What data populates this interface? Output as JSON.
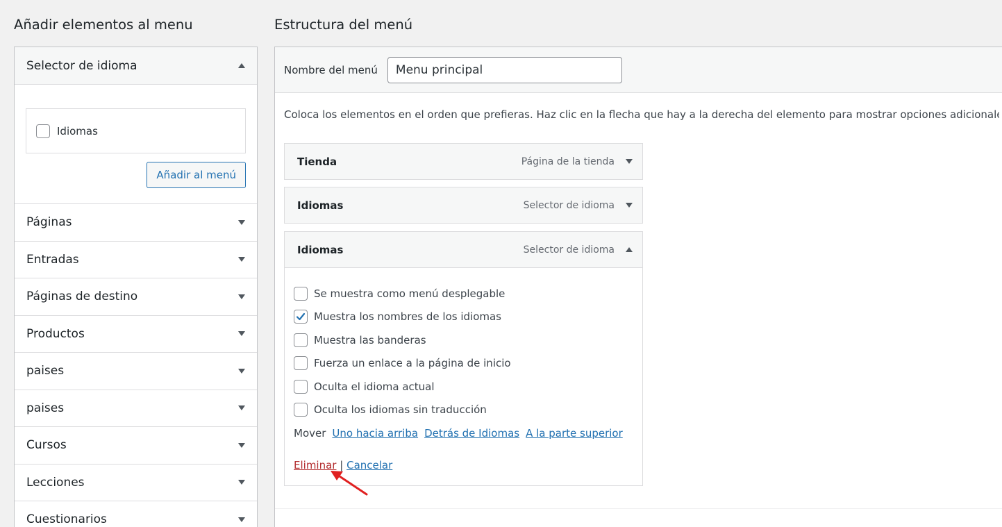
{
  "left": {
    "heading": "Añadir elementos al menu",
    "open_section": {
      "title": "Selector de idioma",
      "option_label": "Idiomas",
      "add_button": "Añadir al menú"
    },
    "sections": [
      "Páginas",
      "Entradas",
      "Páginas de destino",
      "Productos",
      "paises",
      "paises",
      "Cursos",
      "Lecciones",
      "Cuestionarios"
    ]
  },
  "right": {
    "heading": "Estructura del menú",
    "name_label": "Nombre del menú",
    "name_value": "Menu principal",
    "instructions": "Coloca los elementos en el orden que prefieras. Haz clic en la flecha que hay a la derecha del elemento para mostrar opciones adicionales de con",
    "items": [
      {
        "title": "Tienda",
        "type": "Página de la tienda"
      },
      {
        "title": "Idiomas",
        "type": "Selector de idioma"
      },
      {
        "title": "Idiomas",
        "type": "Selector de idioma"
      }
    ],
    "options": [
      {
        "label": "Se muestra como menú desplegable",
        "checked": false
      },
      {
        "label": "Muestra los nombres de los idiomas",
        "checked": true
      },
      {
        "label": "Muestra las banderas",
        "checked": false
      },
      {
        "label": "Fuerza un enlace a la página de inicio",
        "checked": false
      },
      {
        "label": "Oculta el idioma actual",
        "checked": false
      },
      {
        "label": "Oculta los idiomas sin traducción",
        "checked": false
      }
    ],
    "move": {
      "label": "Mover",
      "up_one": "Uno hacia arriba",
      "under": "Detrás de Idiomas",
      "to_top": "A la parte superior"
    },
    "actions": {
      "delete": "Eliminar",
      "separator": "|",
      "cancel": "Cancelar"
    }
  },
  "colors": {
    "accent": "#2271b1",
    "delete": "#b32d2e",
    "annotation_arrow": "#e02020"
  }
}
